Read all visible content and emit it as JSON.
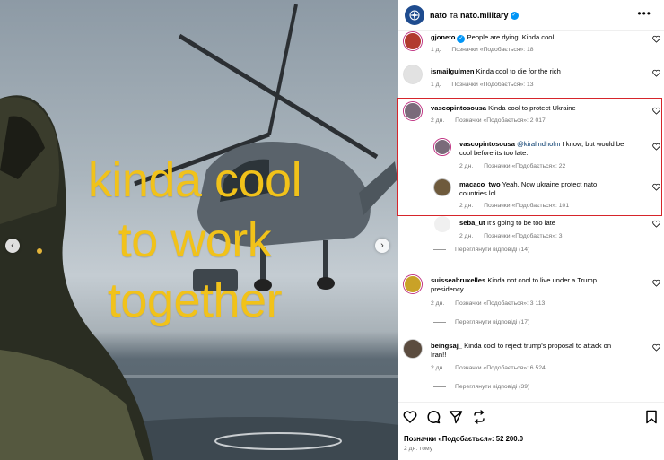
{
  "post": {
    "overlay_lines": [
      "kinda cool",
      "to work",
      "together"
    ]
  },
  "header": {
    "account1": "nato",
    "connector": "та",
    "account2": "nato.military",
    "more": "•••"
  },
  "comments": [
    {
      "user": "gjoneto",
      "verified": true,
      "text": "People are dying. Kinda cool",
      "time": "1 д.",
      "likes": "Позначки «Подобається»: 18",
      "reply": ""
    },
    {
      "user": "ismailgulmen",
      "verified": false,
      "text": "Kinda cool to die for the rich",
      "time": "1 д.",
      "likes": "Позначки «Подобається»: 13",
      "reply": ""
    },
    {
      "user": "vascopintosousa",
      "verified": false,
      "text": "Kinda cool to protect Ukraine",
      "time": "2 дн.",
      "likes": "Позначки «Подобається»: 2 017",
      "reply": ""
    },
    {
      "user": "vascopintosousa",
      "verified": false,
      "mention": "@kiralindholm",
      "text_line1": "I know, but would be",
      "text_line2": "cool before its too late.",
      "time": "2 дн.",
      "likes": "Позначки «Подобається»: 22",
      "reply": ""
    },
    {
      "user": "macaco_two",
      "verified": false,
      "text_line1": "Yeah. Now ukraine protect nato",
      "text_line2": "countries lol",
      "time": "2 дн.",
      "likes": "Позначки «Подобається»: 101",
      "reply": ""
    },
    {
      "user": "seba_ut",
      "verified": false,
      "text": "It's going to be too late",
      "time": "2 дн.",
      "likes": "Позначки «Подобається»: 3",
      "reply": ""
    },
    {
      "user": "suisseabruxelles",
      "verified": false,
      "text_line1": "Kinda not cool to live under a Trump",
      "text_line2": "presidency.",
      "time": "2 дн.",
      "likes": "Позначки «Подобається»: 3 113",
      "reply": ""
    },
    {
      "user": "beingsaj_",
      "verified": false,
      "text_line1": "Kinda cool to reject trump's proposal to attack on",
      "text_line2": "Iran!!",
      "time": "2 дн.",
      "likes": "Позначки «Подобається»: 6 524",
      "reply": ""
    }
  ],
  "view_replies": [
    "Переглянути відповіді (14)",
    "Переглянути відповіді (17)",
    "Переглянути відповіді (39)"
  ],
  "footer": {
    "likes": "Позначки «Подобається»: 52 200.0",
    "time_ago": "2 дн. тому"
  },
  "colors": {
    "overlay_text": "#f1c21a",
    "highlight_border": "#d6252b",
    "verified": "#0095f6",
    "mention": "#00376b",
    "meta": "#737373"
  }
}
